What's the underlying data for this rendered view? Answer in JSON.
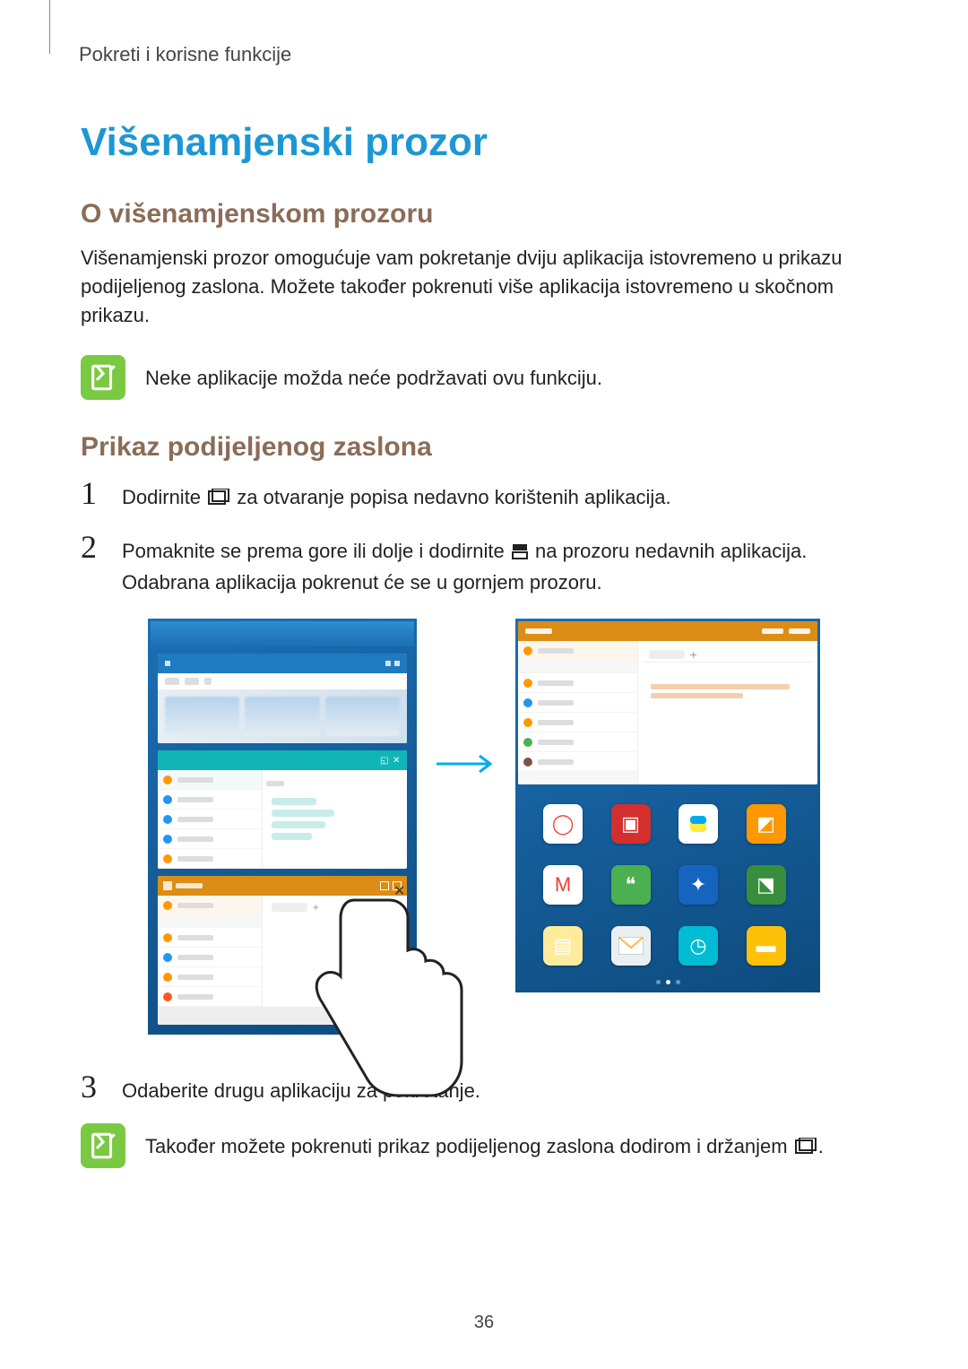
{
  "breadcrumb": "Pokreti i korisne funkcije",
  "title": "Višenamjenski prozor",
  "section1": {
    "heading": "O višenamjenskom prozoru",
    "body": "Višenamjenski prozor omogućuje vam pokretanje dviju aplikacija istovremeno u prikazu podijeljenog zaslona. Možete također pokrenuti više aplikacija istovremeno u skočnom prikazu.",
    "note": "Neke aplikacije možda neće podržavati ovu funkciju."
  },
  "section2": {
    "heading": "Prikaz podijeljenog zaslona",
    "steps": {
      "s1_a": "Dodirnite ",
      "s1_b": " za otvaranje popisa nedavno korištenih aplikacija.",
      "s2_a": "Pomaknite se prema gore ili dolje i dodirnite ",
      "s2_b": " na prozoru nedavnih aplikacija.",
      "s2_c": "Odabrana aplikacija pokrenut će se u gornjem prozoru.",
      "s3": "Odaberite drugu aplikaciju za pokretanje."
    },
    "note2_a": "Također možete pokrenuti prikaz podijeljenog zaslona dodirom i držanjem ",
    "note2_b": "."
  },
  "pageNumber": "36"
}
